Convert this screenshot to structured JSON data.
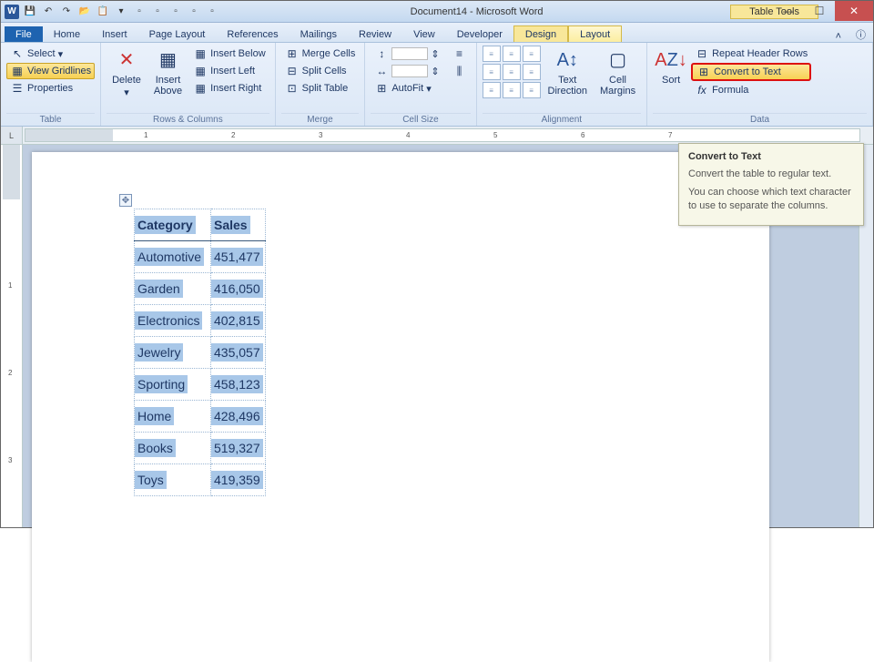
{
  "window": {
    "title": "Document14 - Microsoft Word",
    "contextual_tab_group": "Table Tools"
  },
  "qat": {
    "save": "💾",
    "undo": "↶",
    "redo": "↷",
    "open": "📂",
    "paste": "📋"
  },
  "tabs": [
    "File",
    "Home",
    "Insert",
    "Page Layout",
    "References",
    "Mailings",
    "Review",
    "View",
    "Developer",
    "Design",
    "Layout"
  ],
  "ribbon": {
    "table": {
      "select": "Select",
      "gridlines": "View Gridlines",
      "properties": "Properties",
      "label": "Table"
    },
    "rows_cols": {
      "delete": "Delete",
      "insert_above": "Insert\nAbove",
      "insert_below": "Insert Below",
      "insert_left": "Insert Left",
      "insert_right": "Insert Right",
      "label": "Rows & Columns"
    },
    "merge": {
      "merge": "Merge Cells",
      "split": "Split Cells",
      "split_table": "Split Table",
      "label": "Merge"
    },
    "cellsize": {
      "autofit": "AutoFit",
      "label": "Cell Size"
    },
    "alignment": {
      "direction": "Text\nDirection",
      "margins": "Cell\nMargins",
      "label": "Alignment"
    },
    "data": {
      "sort": "Sort",
      "repeat": "Repeat Header Rows",
      "convert": "Convert to Text",
      "formula": "Formula",
      "label": "Data"
    }
  },
  "tooltip": {
    "title": "Convert to Text",
    "line1": "Convert the table to regular text.",
    "line2": "You can choose which text character to use to separate the columns."
  },
  "table_data": {
    "headers": [
      "Category",
      "Sales"
    ],
    "rows": [
      [
        "Automotive",
        "451,477"
      ],
      [
        "Garden",
        "416,050"
      ],
      [
        "Electronics",
        "402,815"
      ],
      [
        "Jewelry",
        "435,057"
      ],
      [
        "Sporting",
        "458,123"
      ],
      [
        "Home",
        "428,496"
      ],
      [
        "Books",
        "519,327"
      ],
      [
        "Toys",
        "419,359"
      ]
    ]
  },
  "chart_data": {
    "type": "table",
    "title": "",
    "columns": [
      "Category",
      "Sales"
    ],
    "rows": [
      {
        "Category": "Automotive",
        "Sales": 451477
      },
      {
        "Category": "Garden",
        "Sales": 416050
      },
      {
        "Category": "Electronics",
        "Sales": 402815
      },
      {
        "Category": "Jewelry",
        "Sales": 435057
      },
      {
        "Category": "Sporting",
        "Sales": 458123
      },
      {
        "Category": "Home",
        "Sales": 428496
      },
      {
        "Category": "Books",
        "Sales": 519327
      },
      {
        "Category": "Toys",
        "Sales": 419359
      }
    ]
  }
}
